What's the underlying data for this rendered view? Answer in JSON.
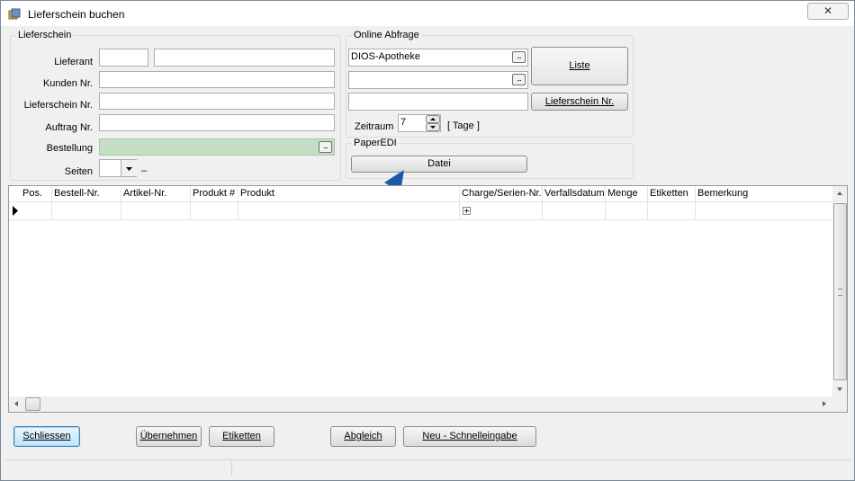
{
  "window": {
    "title": "Lieferschein buchen",
    "close_label": "✕"
  },
  "lieferschein_group": {
    "title": "Lieferschein",
    "labels": {
      "lieferant": "Lieferant",
      "kunden_nr": "Kunden Nr.",
      "lieferschein_nr": "Lieferschein Nr.",
      "auftrag_nr": "Auftrag Nr.",
      "bestellung": "Bestellung",
      "seiten": "Seiten"
    },
    "values": {
      "lieferant_code": "",
      "lieferant_name": "",
      "kunden_nr": "",
      "lieferschein_nr": "",
      "auftrag_nr": "",
      "bestellung": "",
      "seiten": ""
    },
    "seiten_suffix": "–",
    "bestellung_color": "#c4dfc4"
  },
  "online_group": {
    "title": "Online Abfrage",
    "field1_value": "DIOS-Apotheke",
    "field2_value": "",
    "field3_value": "",
    "liste_label": "Liste",
    "lieferschein_btn_label": "Lieferschein Nr.",
    "zeitraum_label": "Zeitraum",
    "zeitraum_value": "7",
    "tage_label": "[ Tage ]"
  },
  "paperedi_group": {
    "title": "PaperEDI",
    "datei_label": "Datei"
  },
  "grid": {
    "columns": [
      "Pos.",
      "Bestell-Nr.",
      "Artikel-Nr.",
      "Produkt #",
      "Produkt",
      "Charge/Serien-Nr.",
      "Verfallsdatum",
      "Menge",
      "Etiketten",
      "Bemerkung"
    ]
  },
  "buttons": {
    "schliessen": "Schliessen",
    "uebernehmen": "Übernehmen",
    "etiketten": "Etiketten",
    "abgleich": "Abgleich",
    "neu_schnelleingabe": "Neu - Schnelleingabe"
  },
  "annotation": {
    "arrow_color": "#1a5aa8"
  }
}
